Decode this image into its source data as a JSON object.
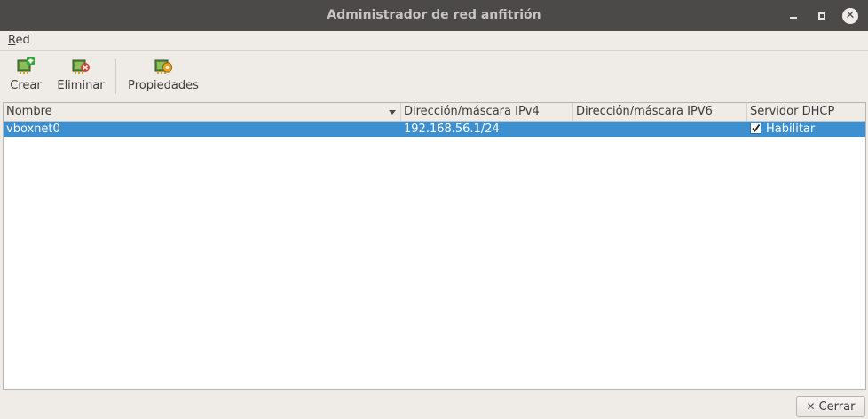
{
  "window": {
    "title": "Administrador de red anfitrión"
  },
  "menu": {
    "items": [
      {
        "label": "Red",
        "mnemonic": "R",
        "rest": "ed"
      }
    ]
  },
  "toolbar": {
    "create_label": "Crear",
    "delete_label": "Eliminar",
    "properties_label": "Propiedades"
  },
  "table": {
    "columns": [
      "Nombre",
      "Dirección/máscara IPv4",
      "Dirección/máscara IPV6",
      "Servidor DHCP"
    ],
    "sort_column": "Nombre",
    "rows": [
      {
        "name": "vboxnet0",
        "ipv4": "192.168.56.1/24",
        "ipv6": "",
        "dhcp_label": "Habilitar",
        "dhcp_enabled": true,
        "selected": true
      }
    ]
  },
  "footer": {
    "close_label": "Cerrar"
  },
  "colors": {
    "titlebar": "#4c4a48",
    "background": "#efebe7",
    "selection": "#3d8fd0"
  }
}
